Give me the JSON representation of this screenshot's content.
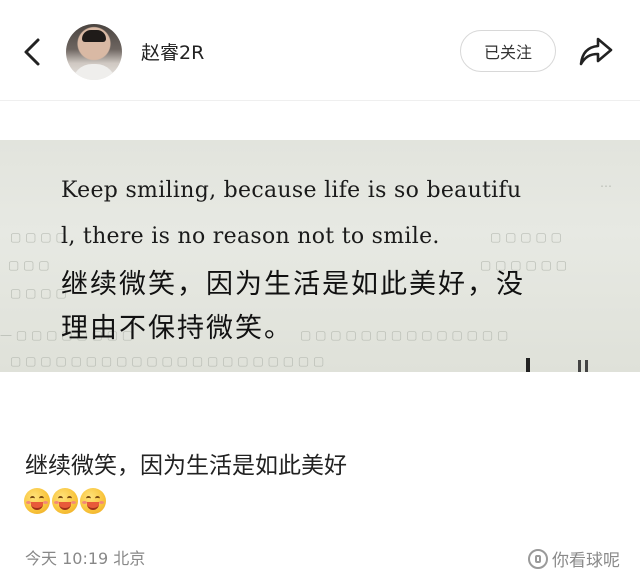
{
  "header": {
    "username": "赵睿2R",
    "follow_label": "已关注"
  },
  "photo": {
    "english_line1": "Keep smiling, because life is so beautifu",
    "english_line2": "l, there is no reason not to smile.",
    "chinese_line1": "继续微笑，因为生活是如此美好，没",
    "chinese_line2": "理由不保持微笑。"
  },
  "post": {
    "text": "继续微笑，因为生活是如此美好",
    "emoji_count": 3,
    "emoji_name": "grin-emoji"
  },
  "meta": {
    "time_location": "今天 10:19 北京"
  },
  "watermark": {
    "text": "你看球呢"
  }
}
